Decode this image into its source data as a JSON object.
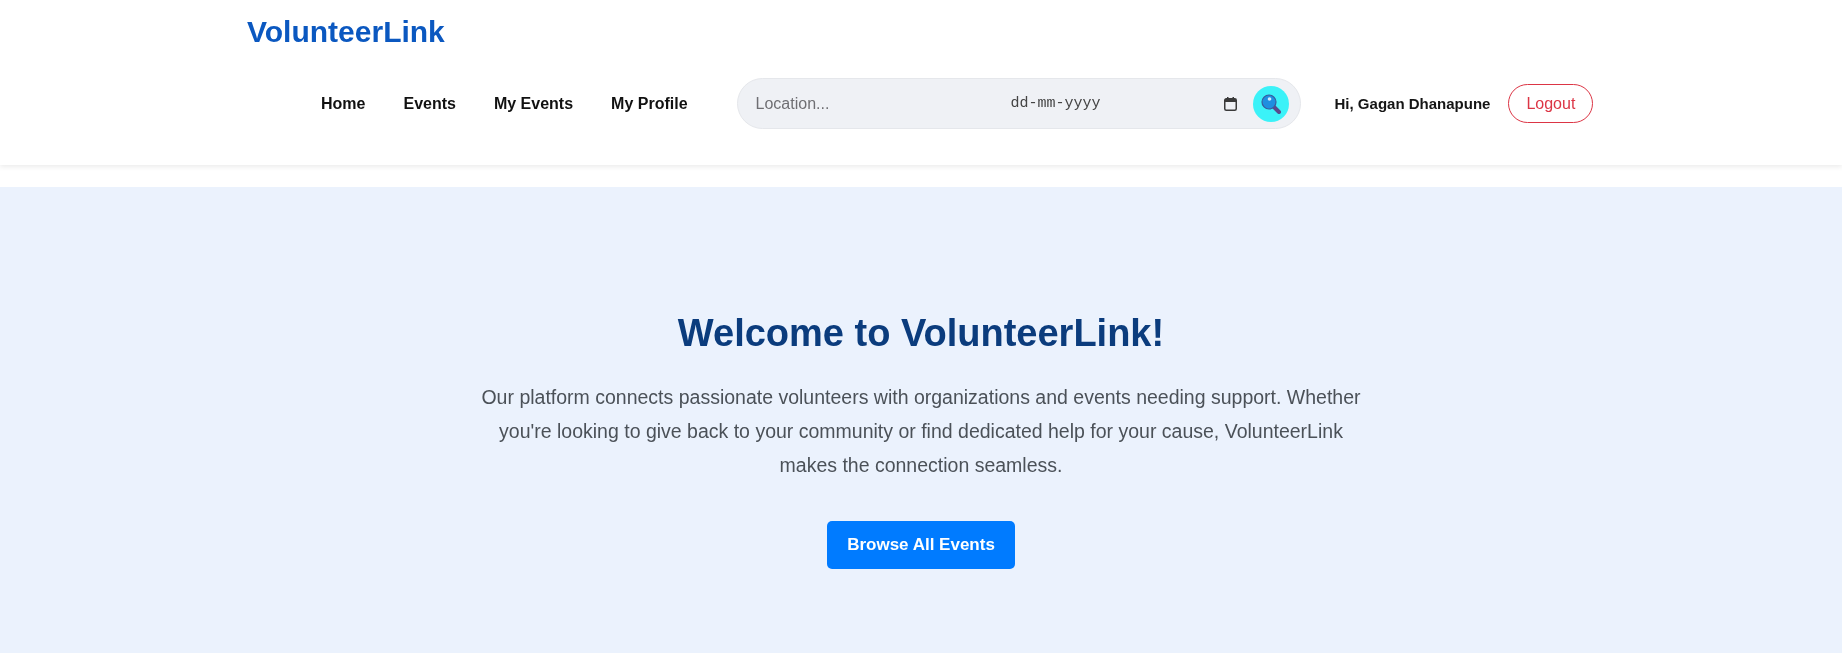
{
  "header": {
    "logo": "VolunteerLink",
    "nav": [
      {
        "label": "Home"
      },
      {
        "label": "Events"
      },
      {
        "label": "My Events"
      },
      {
        "label": "My Profile"
      }
    ],
    "search": {
      "location": {
        "placeholder": "Location..."
      },
      "date": {
        "placeholder": "dd-mm-yyyy"
      }
    },
    "greeting": "Hi, Gagan Dhanapune",
    "logout": "Logout"
  },
  "hero": {
    "title": "Welcome to VolunteerLink!",
    "text": "Our platform connects passionate volunteers with organizations and events needing support. Whether you're looking to give back to your community or find dedicated help for your cause, VolunteerLink makes the connection seamless.",
    "button": "Browse All Events"
  }
}
